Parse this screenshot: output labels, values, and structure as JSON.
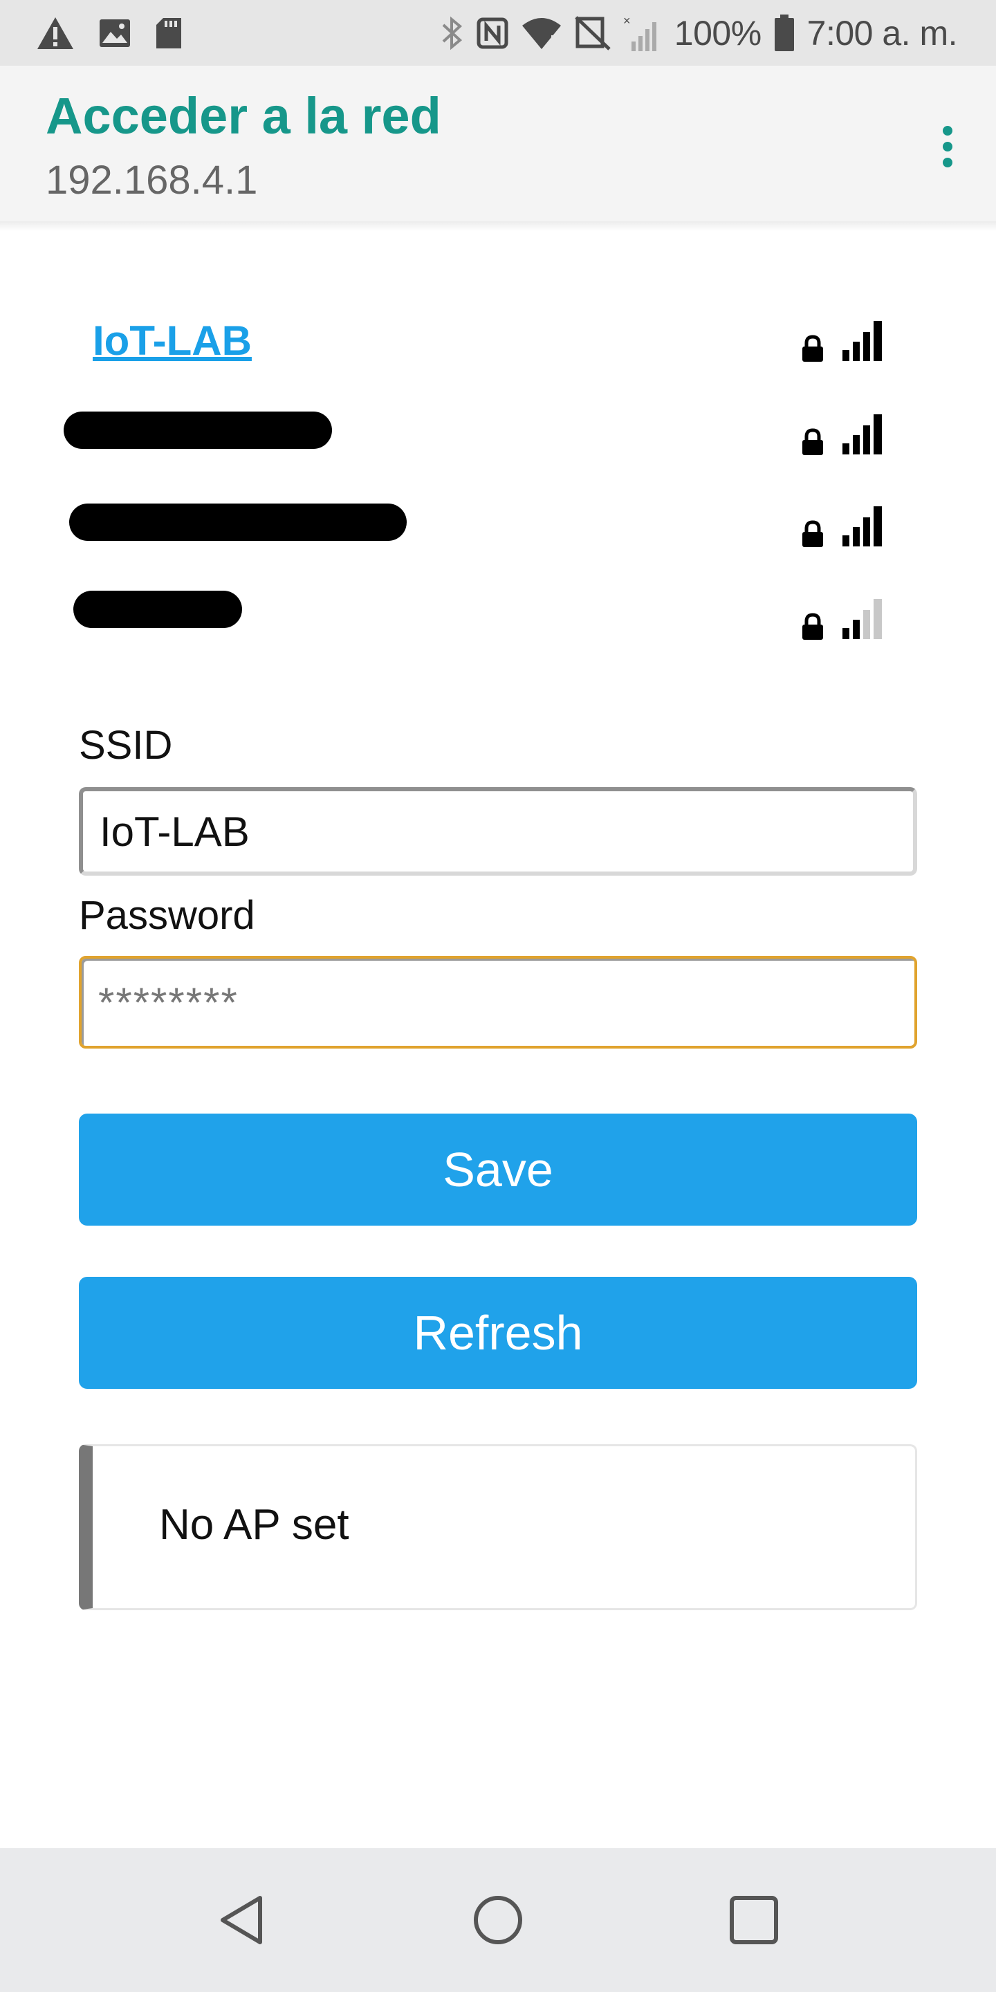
{
  "status_bar": {
    "battery_text": "100%",
    "time": "7:00 a. m.",
    "left_icons": [
      "warning-icon",
      "image-icon",
      "sd-card-icon"
    ],
    "right_icons": [
      "bluetooth-icon",
      "nfc-icon",
      "wifi-icon",
      "signal-off-icon",
      "signal-no-service-icon",
      "battery-icon"
    ]
  },
  "header": {
    "title": "Acceder a la red",
    "subtitle": "192.168.4.1",
    "menu_icon": "more-vert-icon"
  },
  "networks": [
    {
      "ssid": "IoT-LAB",
      "locked": true,
      "signal_bars": 4
    },
    {
      "ssid": "",
      "redacted": true,
      "locked": true,
      "signal_bars": 4
    },
    {
      "ssid": "",
      "redacted": true,
      "locked": true,
      "signal_bars": 4
    },
    {
      "ssid": "",
      "redacted": true,
      "locked": true,
      "signal_bars": 2
    }
  ],
  "form": {
    "ssid_label": "SSID",
    "ssid_value": "IoT-LAB",
    "password_label": "Password",
    "password_placeholder": "********",
    "save_label": "Save",
    "refresh_label": "Refresh"
  },
  "message": {
    "text": "No AP set"
  },
  "colors": {
    "accent": "#16978a",
    "button": "#20a2ea",
    "link": "#1aa0e8",
    "focus": "#e0a32e"
  },
  "nav_bar": {
    "buttons": [
      "back-icon",
      "home-icon",
      "recents-icon"
    ]
  }
}
